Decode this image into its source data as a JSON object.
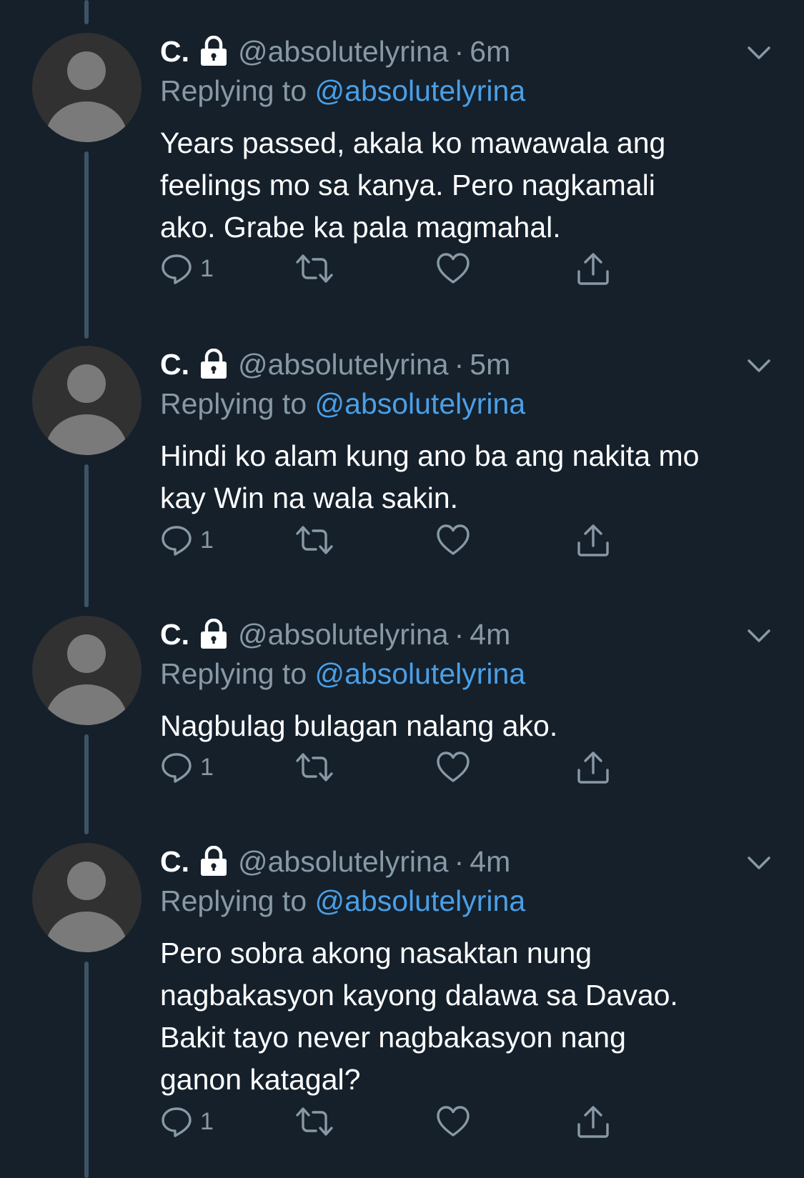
{
  "tweets": [
    {
      "name": "C.",
      "handle": "@absolutelyrina",
      "dot": "·",
      "time": "6m",
      "replying_prefix": "Replying to ",
      "replying_to": "@absolutelyrina",
      "text": "Years passed, akala ko mawawala ang\nfeelings mo sa kanya. Pero nagkamali\nako. Grabe ka pala magmahal.",
      "reply_count": "1"
    },
    {
      "name": "C.",
      "handle": "@absolutelyrina",
      "dot": "·",
      "time": "5m",
      "replying_prefix": "Replying to ",
      "replying_to": "@absolutelyrina",
      "text": "Hindi ko alam kung ano ba ang nakita mo\nkay Win na wala sakin.",
      "reply_count": "1"
    },
    {
      "name": "C.",
      "handle": "@absolutelyrina",
      "dot": "·",
      "time": "4m",
      "replying_prefix": "Replying to ",
      "replying_to": "@absolutelyrina",
      "text": "Nagbulag bulagan nalang ako.",
      "reply_count": "1"
    },
    {
      "name": "C.",
      "handle": "@absolutelyrina",
      "dot": "·",
      "time": "4m",
      "replying_prefix": "Replying to ",
      "replying_to": "@absolutelyrina",
      "text": "Pero sobra akong nasaktan nung\nnagbakasyon kayong dalawa sa Davao.\nBakit tayo never nagbakasyon nang\nganon katagal?",
      "reply_count": "1"
    }
  ],
  "icons": {
    "lock": "lock-icon",
    "chevron": "chevron-down-icon",
    "reply": "reply-icon",
    "retweet": "retweet-icon",
    "like": "heart-icon",
    "share": "share-icon"
  },
  "colors": {
    "background": "#15202b",
    "secondary_text": "#8899a6",
    "mention": "#4a9fe6",
    "thread_line": "#3d5466"
  }
}
